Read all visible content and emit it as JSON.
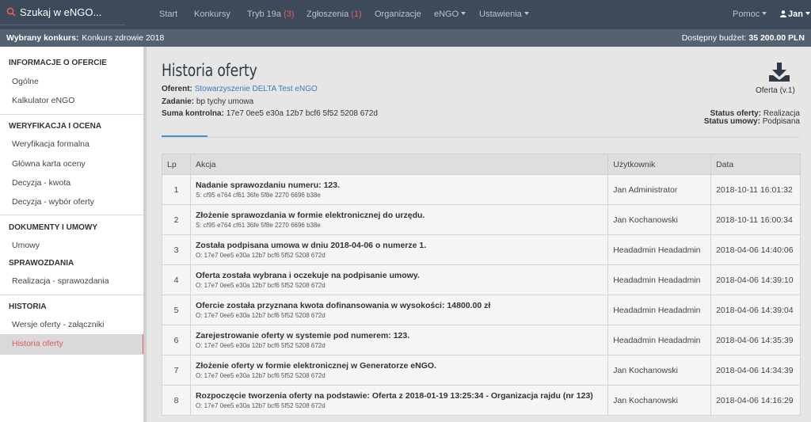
{
  "search": {
    "label": "Szukaj w eNGO..."
  },
  "nav": {
    "items": [
      {
        "label": "Start",
        "count": ""
      },
      {
        "label": "Konkursy",
        "count": ""
      },
      {
        "label": "Tryb 19a",
        "count": "(3)"
      },
      {
        "label": "Zgłoszenia",
        "count": "(1)"
      },
      {
        "label": "Organizacje",
        "count": ""
      },
      {
        "label": "eNGO",
        "count": ""
      },
      {
        "label": "Ustawienia",
        "count": ""
      }
    ],
    "help": "Pomoc",
    "user": "Jan"
  },
  "subbar": {
    "contest_label": "Wybrany konkurs:",
    "contest_value": "Konkurs zdrowie 2018",
    "budget_label": "Dostępny budżet:",
    "budget_value": "35 200.00 PLN"
  },
  "sidebar": {
    "sections": [
      {
        "title": "INFORMACJE O OFERCIE",
        "items": [
          "Ogólne",
          "Kalkulator eNGO"
        ]
      },
      {
        "title": "WERYFIKACJA I OCENA",
        "items": [
          "Weryfikacja formalna",
          "Główna karta oceny",
          "Decyzja - kwota",
          "Decyzja - wybór oferty"
        ]
      },
      {
        "title": "DOKUMENTY I UMOWY",
        "items": [
          "Umowy"
        ]
      },
      {
        "title": "SPRAWOZDANIA",
        "items": [
          "Realizacja - sprawozdania"
        ]
      },
      {
        "title": "HISTORIA",
        "items": [
          "Wersje oferty - załączniki",
          "Historia oferty"
        ]
      }
    ],
    "active": "Historia oferty"
  },
  "page": {
    "title": "Historia oferty",
    "oferent_label": "Oferent:",
    "oferent_value": "Stowarzyszenie DELTA Test eNGO",
    "zadanie_label": "Zadanie:",
    "zadanie_value": "bp tychy umowa",
    "suma_label": "Suma kontrolna:",
    "suma_value": "17e7 0ee5 e30a 12b7 bcf6 5f52 5208 672d",
    "download_label": "Oferta (v.1)",
    "status_oferty_label": "Status oferty:",
    "status_oferty_value": "Realizacja",
    "status_umowy_label": "Status umowy:",
    "status_umowy_value": "Podpisana"
  },
  "table": {
    "headers": [
      "Lp",
      "Akcja",
      "Użytkownik",
      "Data"
    ],
    "rows": [
      {
        "lp": "1",
        "action": "Nadanie sprawozdaniu numeru: 123.",
        "hash": "S: cf95 e764 cf61 36fe 5f8e 2270 6696 b38e",
        "user": "Jan Administrator",
        "date": "2018-10-11 16:01:32"
      },
      {
        "lp": "2",
        "action": "Złożenie sprawozdania w formie elektronicznej do urzędu.",
        "hash": "S: cf95 e764 cf61 36fe 5f8e 2270 6696 b38e",
        "user": "Jan Kochanowski",
        "date": "2018-10-11 16:00:34"
      },
      {
        "lp": "3",
        "action": "Została podpisana umowa w dniu 2018-04-06 o numerze 1.",
        "hash": "O: 17e7 0ee5 e30a 12b7 bcf6 5f52 5208 672d",
        "user": "Headadmin Headadmin",
        "date": "2018-04-06 14:40:06"
      },
      {
        "lp": "4",
        "action": "Oferta została wybrana i oczekuje na podpisanie umowy.",
        "hash": "O: 17e7 0ee5 e30a 12b7 bcf6 5f52 5208 672d",
        "user": "Headadmin Headadmin",
        "date": "2018-04-06 14:39:10"
      },
      {
        "lp": "5",
        "action": "Ofercie została przyznana kwota dofinansowania w wysokości: 14800.00 zł",
        "hash": "O: 17e7 0ee5 e30a 12b7 bcf6 5f52 5208 672d",
        "user": "Headadmin Headadmin",
        "date": "2018-04-06 14:39:04"
      },
      {
        "lp": "6",
        "action": "Zarejestrowanie oferty w systemie pod numerem: 123.",
        "hash": "O: 17e7 0ee5 e30a 12b7 bcf6 5f52 5208 672d",
        "user": "Headadmin Headadmin",
        "date": "2018-04-06 14:35:39"
      },
      {
        "lp": "7",
        "action": "Złożenie oferty w formie elektronicznej w Generatorze eNGO.",
        "hash": "O: 17e7 0ee5 e30a 12b7 bcf6 5f52 5208 672d",
        "user": "Jan Kochanowski",
        "date": "2018-04-06 14:34:39"
      },
      {
        "lp": "8",
        "action": "Rozpoczęcie tworzenia oferty na podstawie: Oferta z 2018-01-19 13:25:34 - Organizacja rajdu (nr 123)",
        "hash": "O: 17e7 0ee5 e30a 12b7 bcf6 5f52 5208 672d",
        "user": "Jan Kochanowski",
        "date": "2018-04-06 14:16:29"
      }
    ]
  },
  "colors": {
    "navbar": "#3c4a5a",
    "subbar": "#536170",
    "accent": "#e05a5a",
    "link": "#3a7bbf"
  },
  "icons": {
    "search": "search-icon",
    "user": "user-icon",
    "download": "download-icon"
  }
}
